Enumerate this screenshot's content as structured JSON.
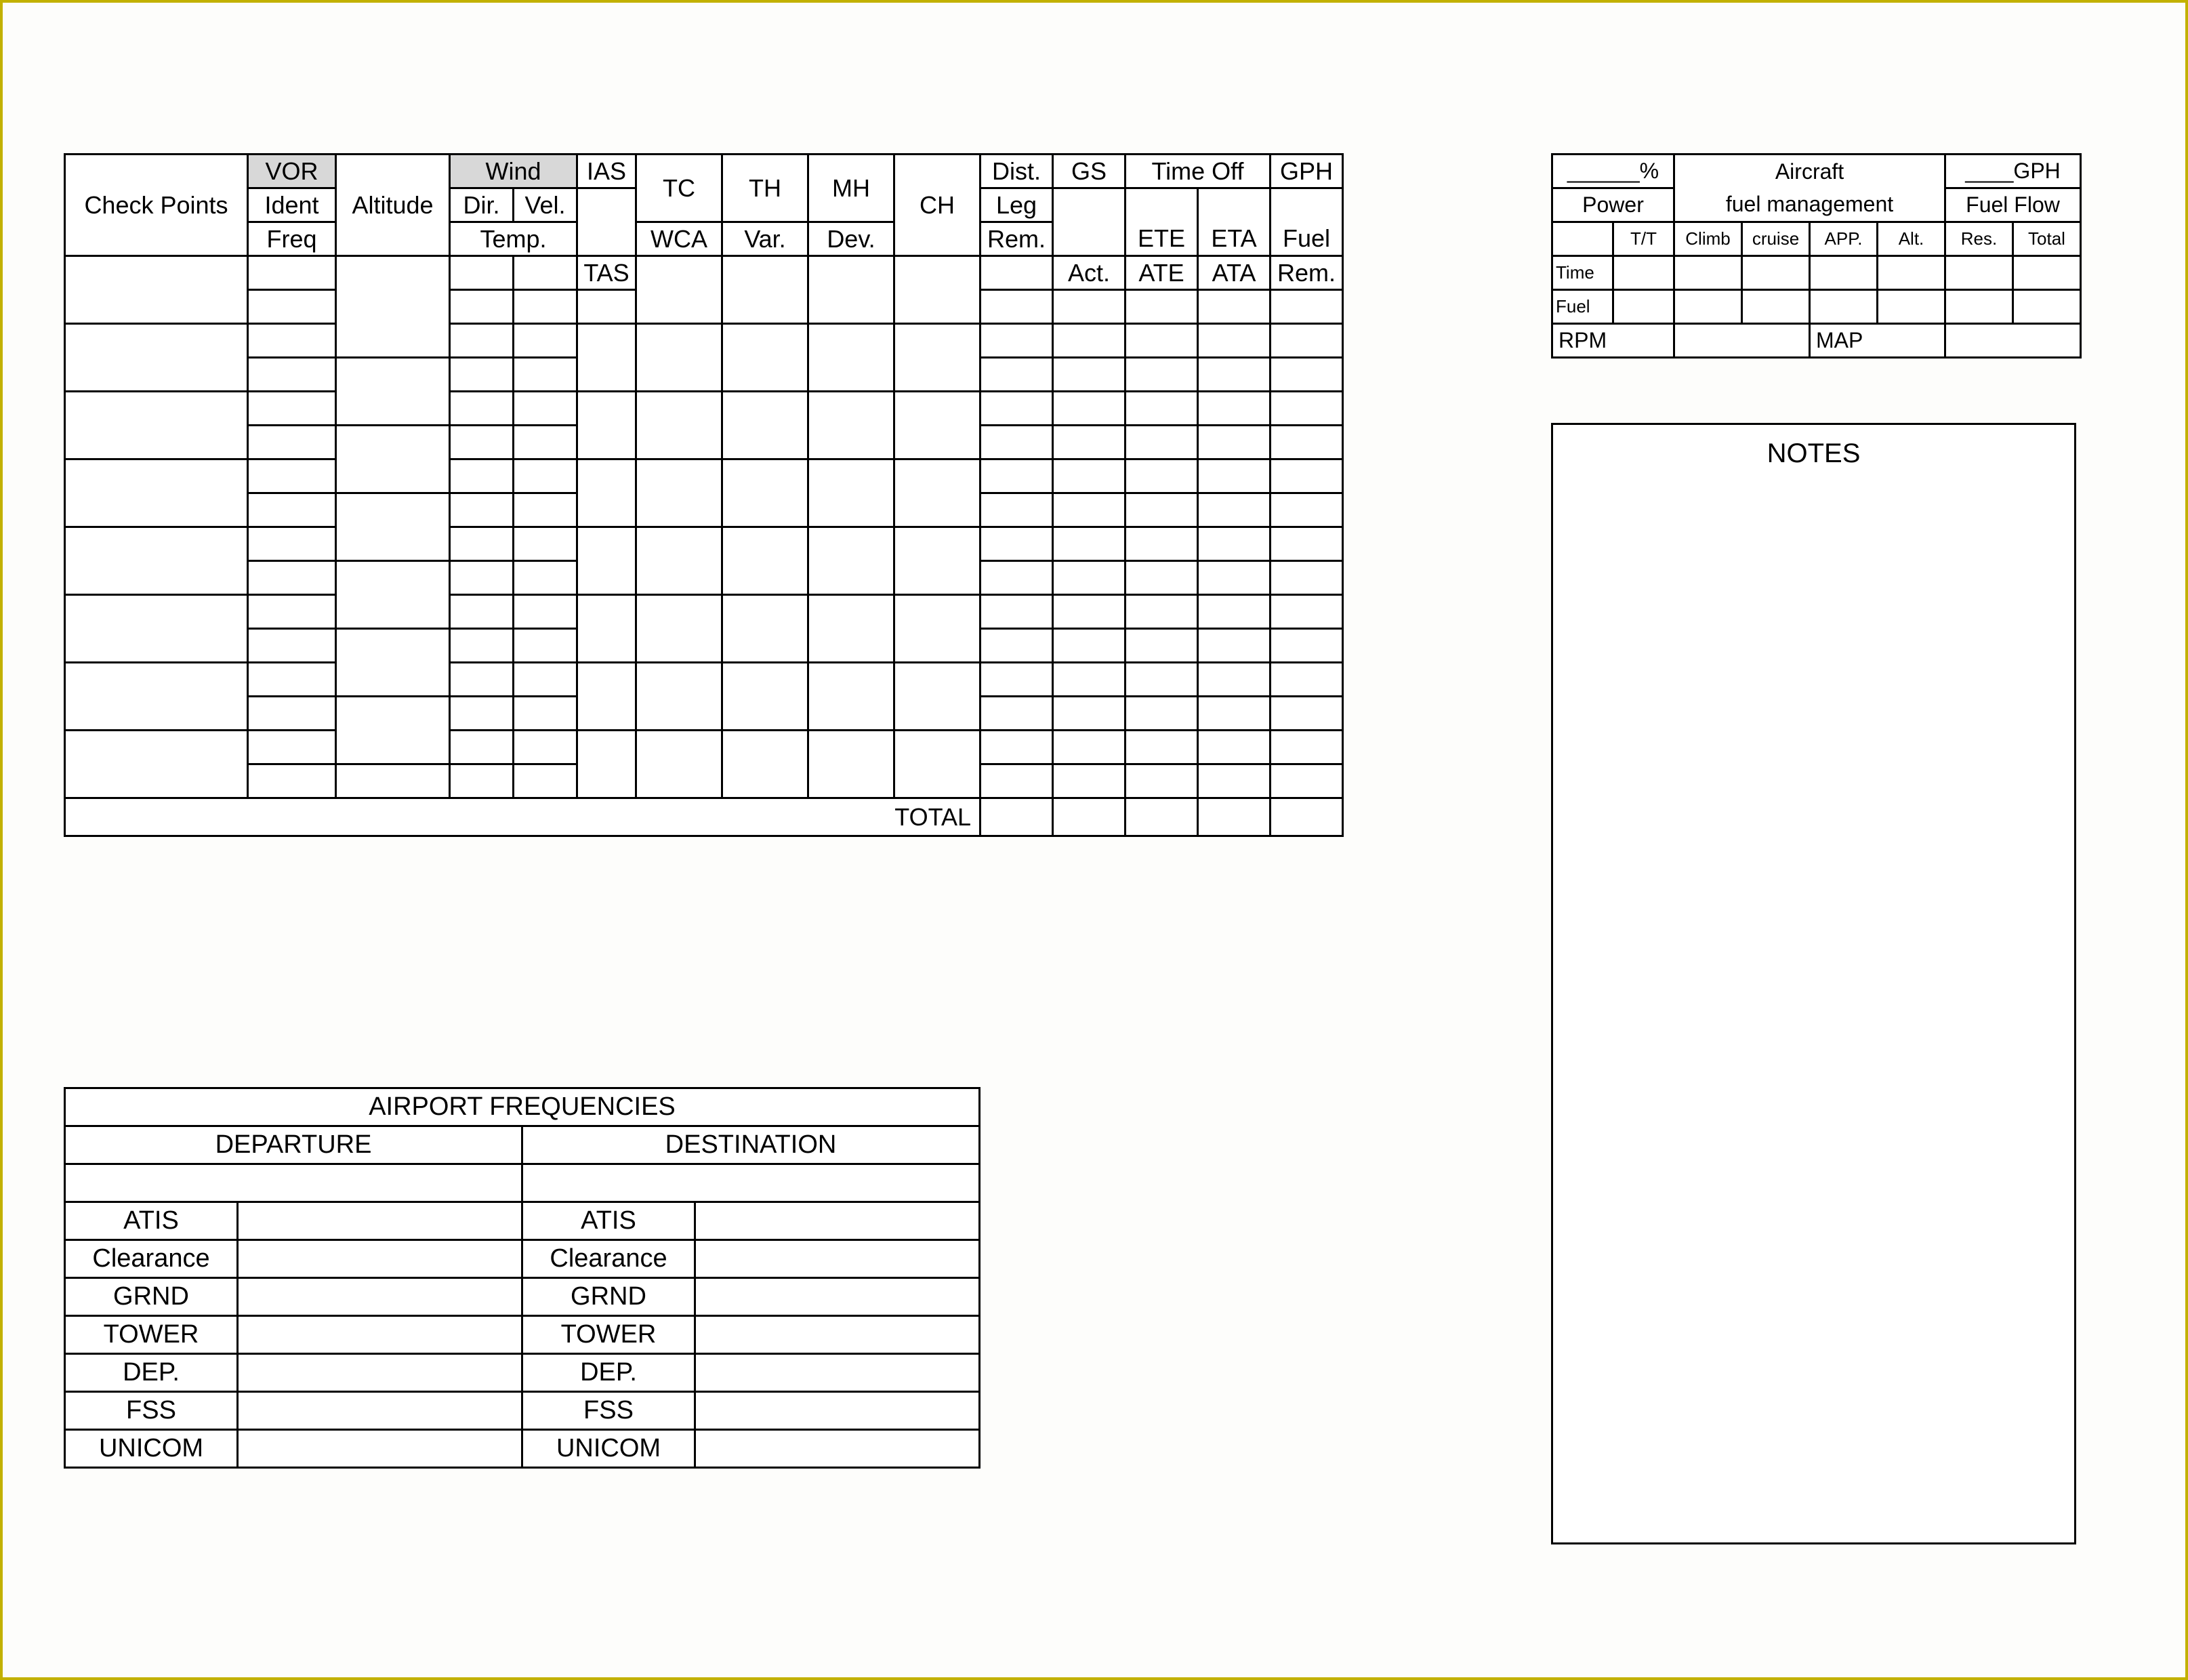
{
  "flight_log": {
    "checkpoints_header": "Check Points",
    "vor": "VOR",
    "ident": "Ident",
    "freq": "Freq",
    "altitude": "Altitude",
    "wind": "Wind",
    "wind_dir": "Dir.",
    "wind_vel": "Vel.",
    "temp": "Temp.",
    "ias": "IAS",
    "tas": "TAS",
    "tc": "TC",
    "wca": "WCA",
    "th": "TH",
    "var": "Var.",
    "mh": "MH",
    "dev": "Dev.",
    "ch": "CH",
    "dist": "Dist.",
    "leg": "Leg",
    "rem": "Rem.",
    "gs": "GS",
    "act": "Act.",
    "time_off": "Time Off",
    "ete": "ETE",
    "ate": "ATE",
    "eta": "ETA",
    "ata": "ATA",
    "gph": "GPH",
    "fuel": "Fuel",
    "fuel_rem": "Rem.",
    "total": "TOTAL"
  },
  "fuel_mgmt": {
    "percent": "______%",
    "power": "Power",
    "aircraft": "Aircraft",
    "fuel_management": "fuel management",
    "gph": "____GPH",
    "fuel_flow": "Fuel Flow",
    "tt": "T/T",
    "climb": "Climb",
    "cruise": "cruise",
    "app": "APP.",
    "alt": "Alt.",
    "res": "Res.",
    "total": "Total",
    "time": "Time",
    "fuel": "Fuel",
    "rpm": "RPM",
    "map": "MAP"
  },
  "notes": {
    "heading": "NOTES"
  },
  "freq": {
    "title": "AIRPORT  FREQUENCIES",
    "departure": "DEPARTURE",
    "destination": "DESTINATION",
    "rows": [
      "ATIS",
      "Clearance",
      "GRND",
      "TOWER",
      "DEP.",
      "FSS",
      "UNICOM"
    ]
  }
}
